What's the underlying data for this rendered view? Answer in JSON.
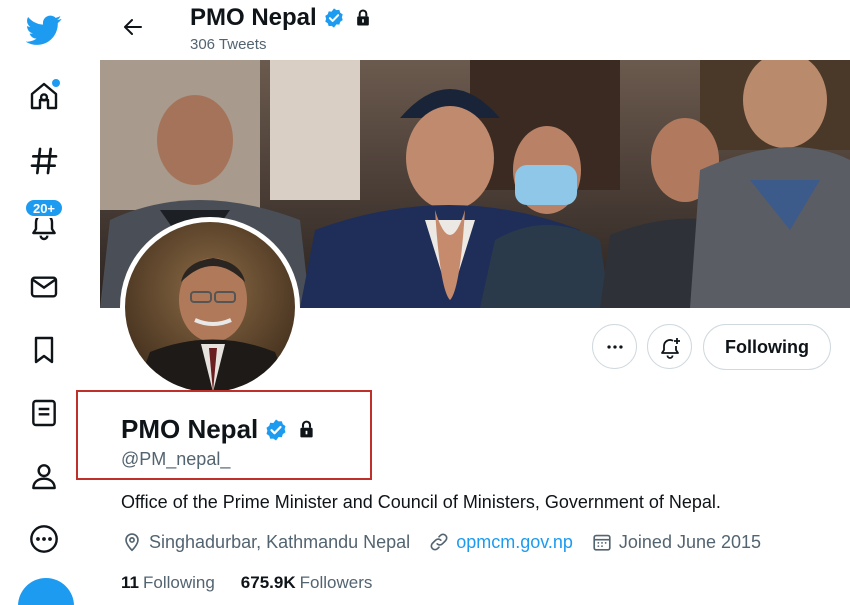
{
  "header": {
    "title": "PMO Nepal",
    "tweet_count": "306 Tweets"
  },
  "sidebar": {
    "items": [
      {
        "name": "twitter-logo"
      },
      {
        "name": "home"
      },
      {
        "name": "explore"
      },
      {
        "name": "notifications",
        "badge": "20+"
      },
      {
        "name": "messages"
      },
      {
        "name": "bookmarks"
      },
      {
        "name": "lists"
      },
      {
        "name": "profile"
      },
      {
        "name": "more"
      }
    ]
  },
  "profile": {
    "name": "PMO Nepal",
    "handle": "@PM_nepal_",
    "bio": "Office of the Prime Minister and Council of Ministers, Government of Nepal.",
    "location": "Singhadurbar, Kathmandu Nepal",
    "website": "opmcm.gov.np",
    "joined": "Joined June 2015",
    "following_count": "11",
    "following_label": "Following",
    "followers_count": "675.9K",
    "followers_label": "Followers"
  },
  "actions": {
    "following_button": "Following"
  },
  "colors": {
    "accent": "#1d9bf0",
    "highlight": "#c0302a",
    "secondary_text": "#536471"
  }
}
